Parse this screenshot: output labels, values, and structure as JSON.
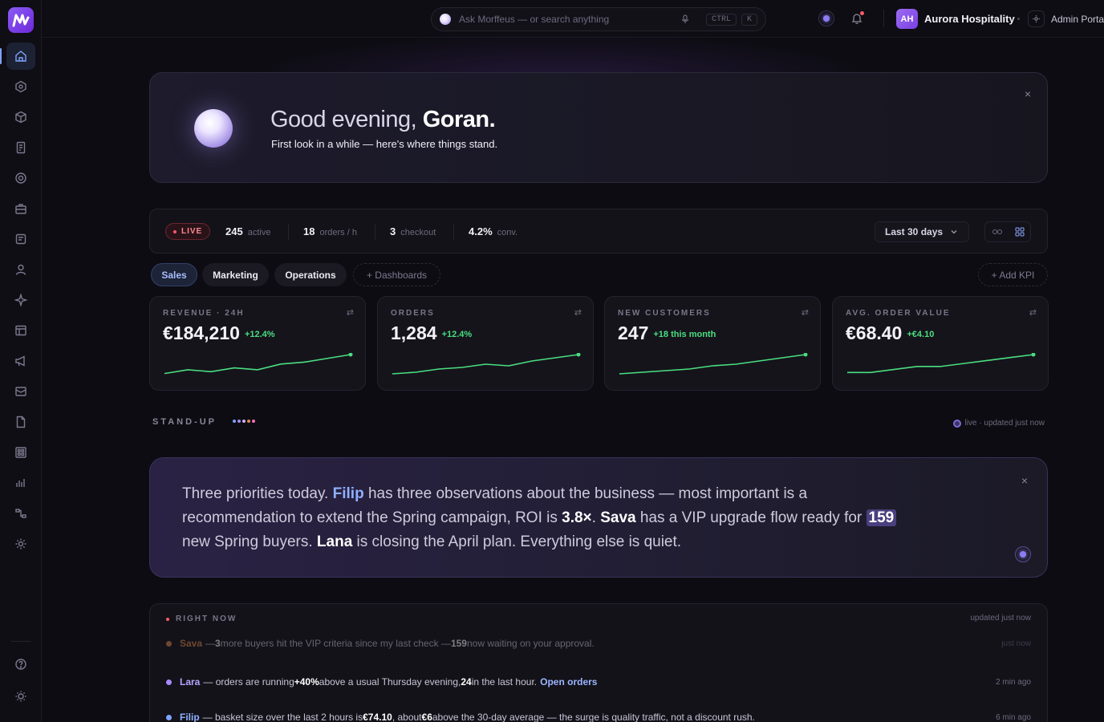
{
  "topbar": {
    "search_placeholder": "Ask Morffeus — or search anything",
    "kbd_ctrl": "CTRL",
    "kbd_k": "K",
    "avatar_initials": "AH",
    "org_name": "Aurora Hospitality",
    "portal_label": "Admin Portal"
  },
  "sidebar": {
    "items": [
      {
        "name": "home-icon",
        "active": true
      },
      {
        "name": "hexagon-icon"
      },
      {
        "name": "box-icon"
      },
      {
        "name": "document-icon"
      },
      {
        "name": "globe-icon"
      },
      {
        "name": "briefcase-icon"
      },
      {
        "name": "list-icon"
      },
      {
        "name": "user-icon"
      },
      {
        "name": "sparkle-icon"
      },
      {
        "name": "table-icon"
      },
      {
        "name": "megaphone-icon"
      },
      {
        "name": "ticket-icon"
      },
      {
        "name": "file-icon"
      },
      {
        "name": "grid-icon"
      },
      {
        "name": "chart-icon"
      },
      {
        "name": "flow-icon"
      },
      {
        "name": "settings-icon"
      }
    ],
    "bottom": [
      {
        "name": "help-icon"
      },
      {
        "name": "theme-icon"
      }
    ]
  },
  "greeting": {
    "prefix": "Good evening,",
    "name": "Goran.",
    "subtitle": "First look in a while — here's where things stand."
  },
  "live": {
    "badge": "LIVE",
    "stats": [
      {
        "value": "245",
        "label": "active"
      },
      {
        "value": "18",
        "label": "orders / h"
      },
      {
        "value": "3",
        "label": "checkout"
      },
      {
        "value": "4.2%",
        "label": "conv."
      }
    ],
    "range": "Last 30 days"
  },
  "tabs": {
    "sales": "Sales",
    "marketing": "Marketing",
    "operations": "Operations",
    "dashboards": "+ Dashboards",
    "add_kpi": "+ Add KPI"
  },
  "kpis": [
    {
      "label": "REVENUE · 24H",
      "value": "€184,210",
      "delta": "+12.4%",
      "trend": [
        4,
        6,
        5,
        7,
        6,
        9,
        10,
        12,
        14
      ]
    },
    {
      "label": "ORDERS",
      "value": "1,284",
      "delta": "+12.4%",
      "trend": [
        3,
        4,
        6,
        7,
        9,
        8,
        11,
        13,
        15
      ]
    },
    {
      "label": "NEW CUSTOMERS",
      "value": "247",
      "delta": "+18 this month",
      "trend": [
        3,
        4,
        5,
        6,
        8,
        9,
        11,
        13,
        15
      ]
    },
    {
      "label": "AVG. ORDER VALUE",
      "value": "€68.40",
      "delta": "+€4.10",
      "trend": [
        5,
        5,
        6,
        7,
        7,
        8,
        9,
        10,
        11
      ]
    }
  ],
  "standup": {
    "label": "STAND-UP",
    "live_note": "live · updated just now",
    "t1": "Three priorities today. ",
    "filip": "Filip",
    "t2": " has three observations about the business — most important is a recommendation to extend the Spring campaign, ROI is ",
    "roi": "3.8×",
    "t3": ". ",
    "sava": "Sava",
    "t4": " has a VIP upgrade flow ready for ",
    "count": "159",
    "t5": " new Spring buyers. ",
    "lana": "Lana",
    "t6": " is closing the April plan. Everything else is quiet."
  },
  "right_now": {
    "label": "RIGHT NOW",
    "updated": "updated just now",
    "rows": [
      {
        "name": "Sava",
        "color": "#e0894a",
        "pre": " — ",
        "b1": "3",
        "mid": " more buyers hit the VIP criteria since my last check — ",
        "b2": "159",
        "post": " now waiting on your approval.",
        "time": "just now",
        "link": ""
      },
      {
        "name": "Lara",
        "color": "#a78bfa",
        "pre": " — orders are running ",
        "b1": "+40%",
        "mid": " above a usual Thursday evening, ",
        "b2": "24",
        "post": " in the last hour.",
        "time": "2 min ago",
        "link": "Open orders"
      },
      {
        "name": "Filip",
        "color": "#7fa4ff",
        "pre": " — basket size over the last 2 hours is ",
        "b1": "€74.10",
        "mid": ", about ",
        "b2": "€6",
        "post": " above the 30-day average — the surge is quality traffic, not a discount rush.",
        "time": "6 min ago",
        "link": ""
      }
    ]
  }
}
